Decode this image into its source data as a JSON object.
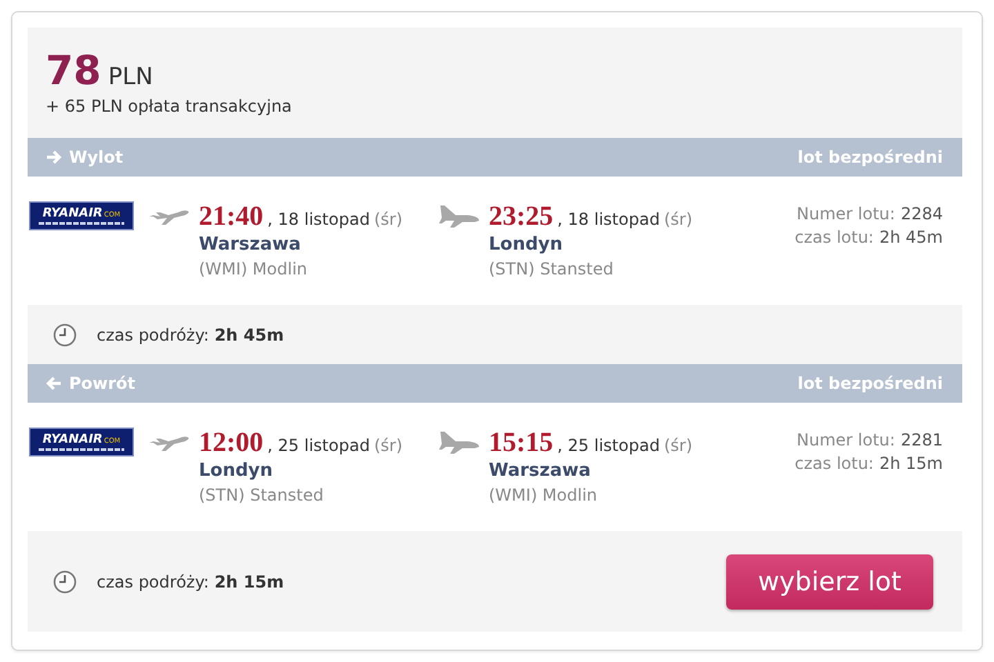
{
  "price": {
    "amount": "78",
    "currency": "PLN",
    "fee": "+ 65 PLN opłata transakcyjna"
  },
  "legs": [
    {
      "kind": "outbound",
      "label": "Wylot",
      "note": "lot bezpośredni",
      "airline": {
        "name": "RYANAIR",
        "suffix": "COM"
      },
      "departure": {
        "time": "21:40",
        "date": ", 18 listopad",
        "weekday": "(śr)",
        "city": "Warszawa",
        "airport": "(WMI) Modlin"
      },
      "arrival": {
        "time": "23:25",
        "date": ", 18 listopad",
        "weekday": "(śr)",
        "city": "Londyn",
        "airport": "(STN) Stansted"
      },
      "flight_number_label": "Numer lotu:",
      "flight_number": "2284",
      "flight_time_label": "czas lotu:",
      "flight_time": "2h 45m",
      "travel_label": "czas podróży:",
      "travel_time": "2h 45m"
    },
    {
      "kind": "return",
      "label": "Powrót",
      "note": "lot bezpośredni",
      "airline": {
        "name": "RYANAIR",
        "suffix": "COM"
      },
      "departure": {
        "time": "12:00",
        "date": ", 25 listopad",
        "weekday": "(śr)",
        "city": "Londyn",
        "airport": "(STN) Stansted"
      },
      "arrival": {
        "time": "15:15",
        "date": ", 25 listopad",
        "weekday": "(śr)",
        "city": "Warszawa",
        "airport": "(WMI) Modlin"
      },
      "flight_number_label": "Numer lotu:",
      "flight_number": "2281",
      "flight_time_label": "czas lotu:",
      "flight_time": "2h 15m",
      "travel_label": "czas podróży:",
      "travel_time": "2h 15m"
    }
  ],
  "button": "wybierz lot"
}
